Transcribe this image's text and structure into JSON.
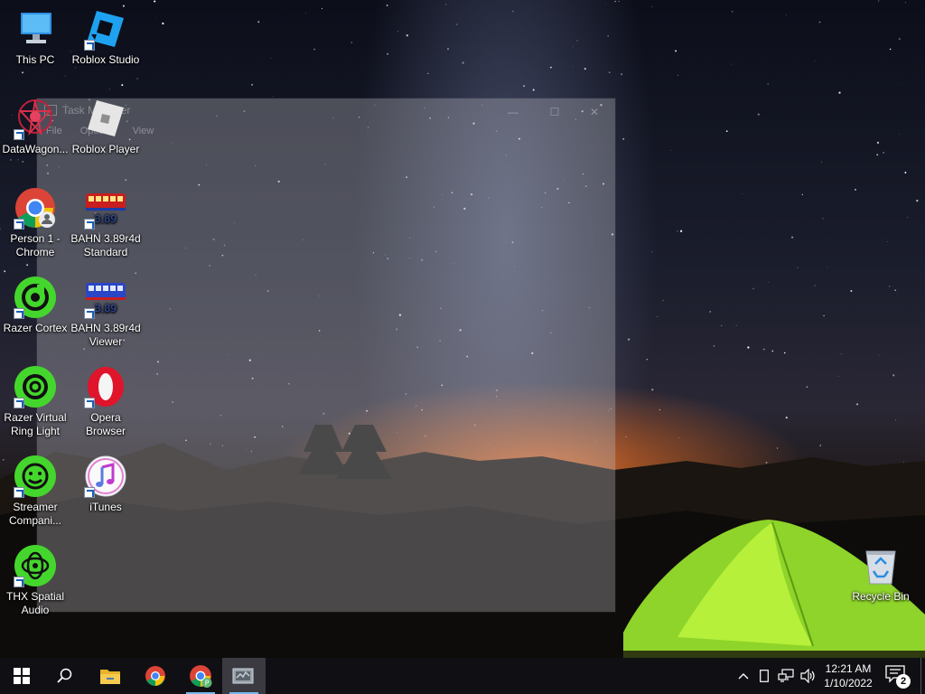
{
  "ghost_window": {
    "title": "Task Manager",
    "menu": [
      "File",
      "Options",
      "View"
    ]
  },
  "desktop_icons": [
    {
      "name": "this-pc",
      "label": "This PC",
      "icon": "computer-icon"
    },
    {
      "name": "roblox-studio",
      "label": "Roblox Studio",
      "icon": "roblox-studio-icon"
    },
    {
      "name": "datawagon",
      "label": "DataWagon...",
      "icon": "datawagon-icon"
    },
    {
      "name": "roblox-player",
      "label": "Roblox Player",
      "icon": "roblox-player-icon"
    },
    {
      "name": "person1-chrome",
      "label": "Person 1 - Chrome",
      "icon": "chrome-icon"
    },
    {
      "name": "bahn-standard",
      "label": "BAHN 3.89r4d Standard",
      "icon": "bahn-icon",
      "badge": "3.89"
    },
    {
      "name": "razer-cortex",
      "label": "Razer Cortex",
      "icon": "razer-cortex-icon"
    },
    {
      "name": "bahn-viewer",
      "label": "BAHN 3.89r4d Viewer",
      "icon": "bahn-viewer-icon",
      "badge": "3.89"
    },
    {
      "name": "razer-ring-light",
      "label": "Razer Virtual Ring Light",
      "icon": "razer-ring-light-icon"
    },
    {
      "name": "opera",
      "label": "Opera Browser",
      "icon": "opera-icon"
    },
    {
      "name": "streamer-companion",
      "label": "Streamer Compani...",
      "icon": "streamer-companion-icon"
    },
    {
      "name": "itunes",
      "label": "iTunes",
      "icon": "itunes-icon"
    },
    {
      "name": "thx-spatial",
      "label": "THX Spatial Audio",
      "icon": "thx-icon"
    },
    {
      "name": "recycle-bin",
      "label": "Recycle Bin",
      "icon": "recycle-bin-icon"
    }
  ],
  "taskbar": {
    "apps": [
      {
        "name": "start",
        "icon": "windows-icon"
      },
      {
        "name": "search",
        "icon": "search-icon"
      },
      {
        "name": "file-explorer",
        "icon": "folder-icon"
      },
      {
        "name": "chrome",
        "icon": "chrome-icon"
      },
      {
        "name": "chrome-profile",
        "icon": "chrome-profile-icon",
        "badge": "P"
      },
      {
        "name": "task-manager",
        "icon": "task-manager-icon"
      }
    ],
    "tray": {
      "icons": [
        "chevron-up-icon",
        "tablet-icon",
        "network-icon",
        "volume-icon"
      ],
      "time": "12:21 AM",
      "date": "1/10/2022",
      "notification_count": "2"
    }
  },
  "colors": {
    "accent": "#76b9ed",
    "taskbar": "#101014",
    "razer_green": "#44d62c",
    "tent_green": "#9be22a"
  }
}
